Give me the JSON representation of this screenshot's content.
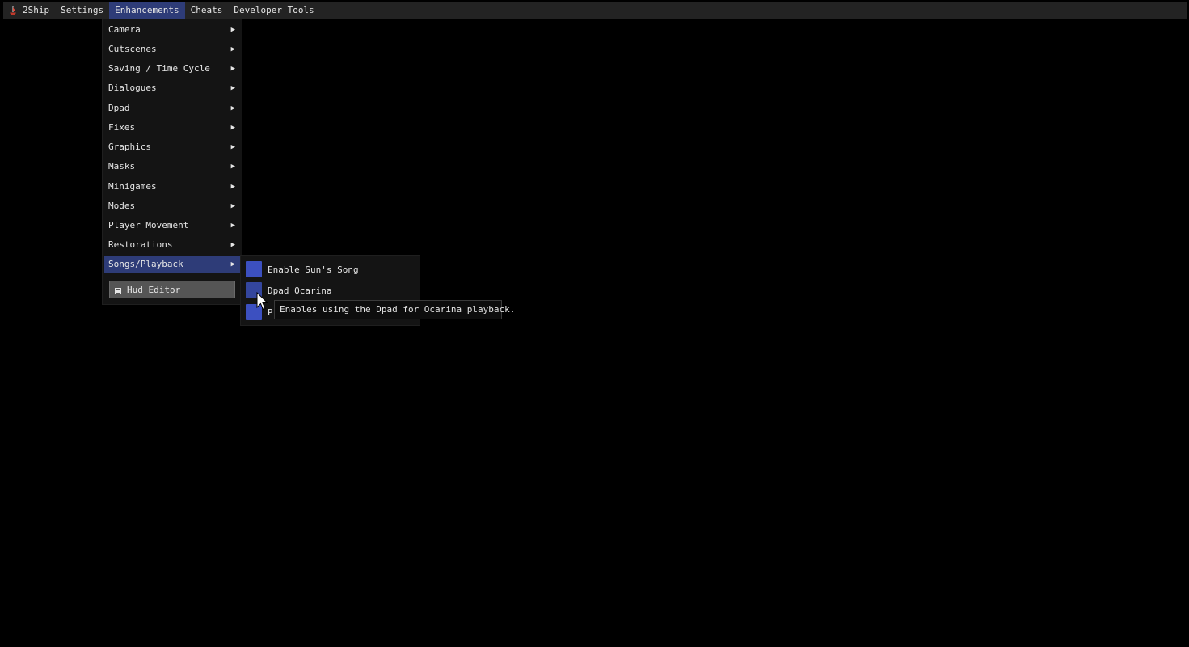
{
  "menubar": {
    "app_label": "2Ship",
    "items": [
      {
        "label": "Settings"
      },
      {
        "label": "Enhancements",
        "active": true
      },
      {
        "label": "Cheats"
      },
      {
        "label": "Developer Tools"
      }
    ]
  },
  "enhancements_menu": {
    "items": [
      {
        "label": "Camera"
      },
      {
        "label": "Cutscenes"
      },
      {
        "label": "Saving / Time Cycle"
      },
      {
        "label": "Dialogues"
      },
      {
        "label": "Dpad"
      },
      {
        "label": "Fixes"
      },
      {
        "label": "Graphics"
      },
      {
        "label": "Masks"
      },
      {
        "label": "Minigames"
      },
      {
        "label": "Modes"
      },
      {
        "label": "Player Movement"
      },
      {
        "label": "Restorations"
      },
      {
        "label": "Songs/Playback",
        "active": true
      }
    ],
    "arrow_glyph": "▶",
    "hud_editor_label": "Hud Editor"
  },
  "songs_playback_submenu": {
    "items": [
      {
        "label": "Enable Sun's Song",
        "checked": true
      },
      {
        "label": "Dpad Ocarina",
        "checked": true
      },
      {
        "label": "P",
        "checked": true
      }
    ]
  },
  "tooltip": {
    "text": "Enables using the Dpad for Ocarina playback."
  },
  "colors": {
    "accent": "#2e3c78",
    "checkbox": "#3c50c0",
    "menu_bg": "#141414",
    "menubar_bg": "#232323",
    "app_icon": "#c0392b"
  },
  "icons": {
    "app": "ship-icon",
    "hud_editor": "hud-editor-icon",
    "cursor": "mouse-pointer-icon"
  }
}
